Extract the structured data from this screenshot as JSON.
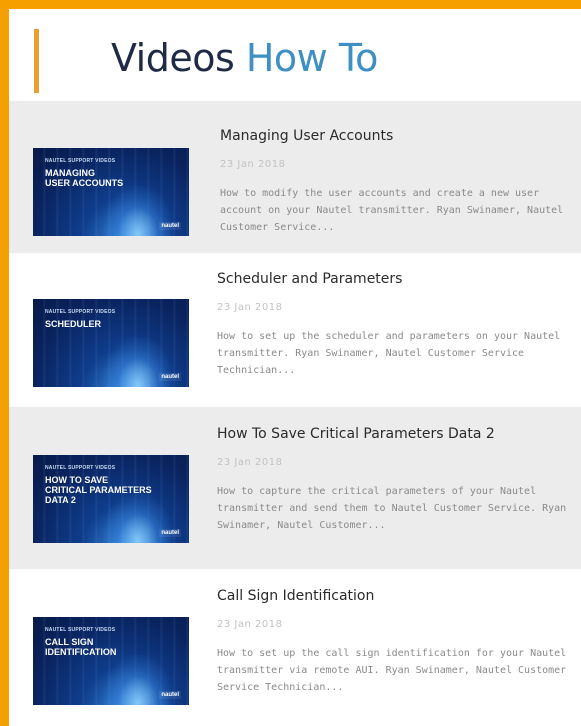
{
  "header": {
    "title_part1": "Videos",
    "title_part2": "How To"
  },
  "colors": {
    "frame": "#f5a000",
    "accent_bar": "#e8a030",
    "title_dark": "#1f2b44",
    "title_blue": "#3d8fc4",
    "row_shaded": "#ececec"
  },
  "videos": [
    {
      "title": "Managing User Accounts",
      "date": "23 Jan 2018",
      "description": "How to modify the user accounts and create a new user account on your Nautel transmitter. Ryan Swinamer, Nautel Customer Service...",
      "thumb_kicker": "NAUTEL SUPPORT VIDEOS",
      "thumb_heading": "MANAGING\nUSER ACCOUNTS",
      "thumb_brand": "nautel"
    },
    {
      "title": "Scheduler and Parameters",
      "date": "23 Jan 2018",
      "description": "How to set up the scheduler and parameters on your Nautel transmitter. Ryan Swinamer, Nautel Customer Service Technician...",
      "thumb_kicker": "NAUTEL SUPPORT VIDEOS",
      "thumb_heading": "SCHEDULER",
      "thumb_brand": "nautel"
    },
    {
      "title": "How To Save Critical Parameters Data 2",
      "date": "23 Jan 2018",
      "description": "How to capture the critical parameters of your Nautel transmitter and send them to Nautel Customer Service. Ryan Swinamer, Nautel Customer...",
      "thumb_kicker": "NAUTEL SUPPORT VIDEOS",
      "thumb_heading": "HOW TO SAVE\nCRITICAL PARAMETERS\nDATA 2",
      "thumb_brand": "nautel"
    },
    {
      "title": "Call Sign Identification",
      "date": "23 Jan 2018",
      "description": "How to set up the call sign identification for your Nautel transmitter via remote AUI. Ryan Swinamer, Nautel Customer Service Technician...",
      "thumb_kicker": "NAUTEL SUPPORT VIDEOS",
      "thumb_heading": "CALL SIGN\nIDENTIFICATION",
      "thumb_brand": "nautel"
    }
  ]
}
